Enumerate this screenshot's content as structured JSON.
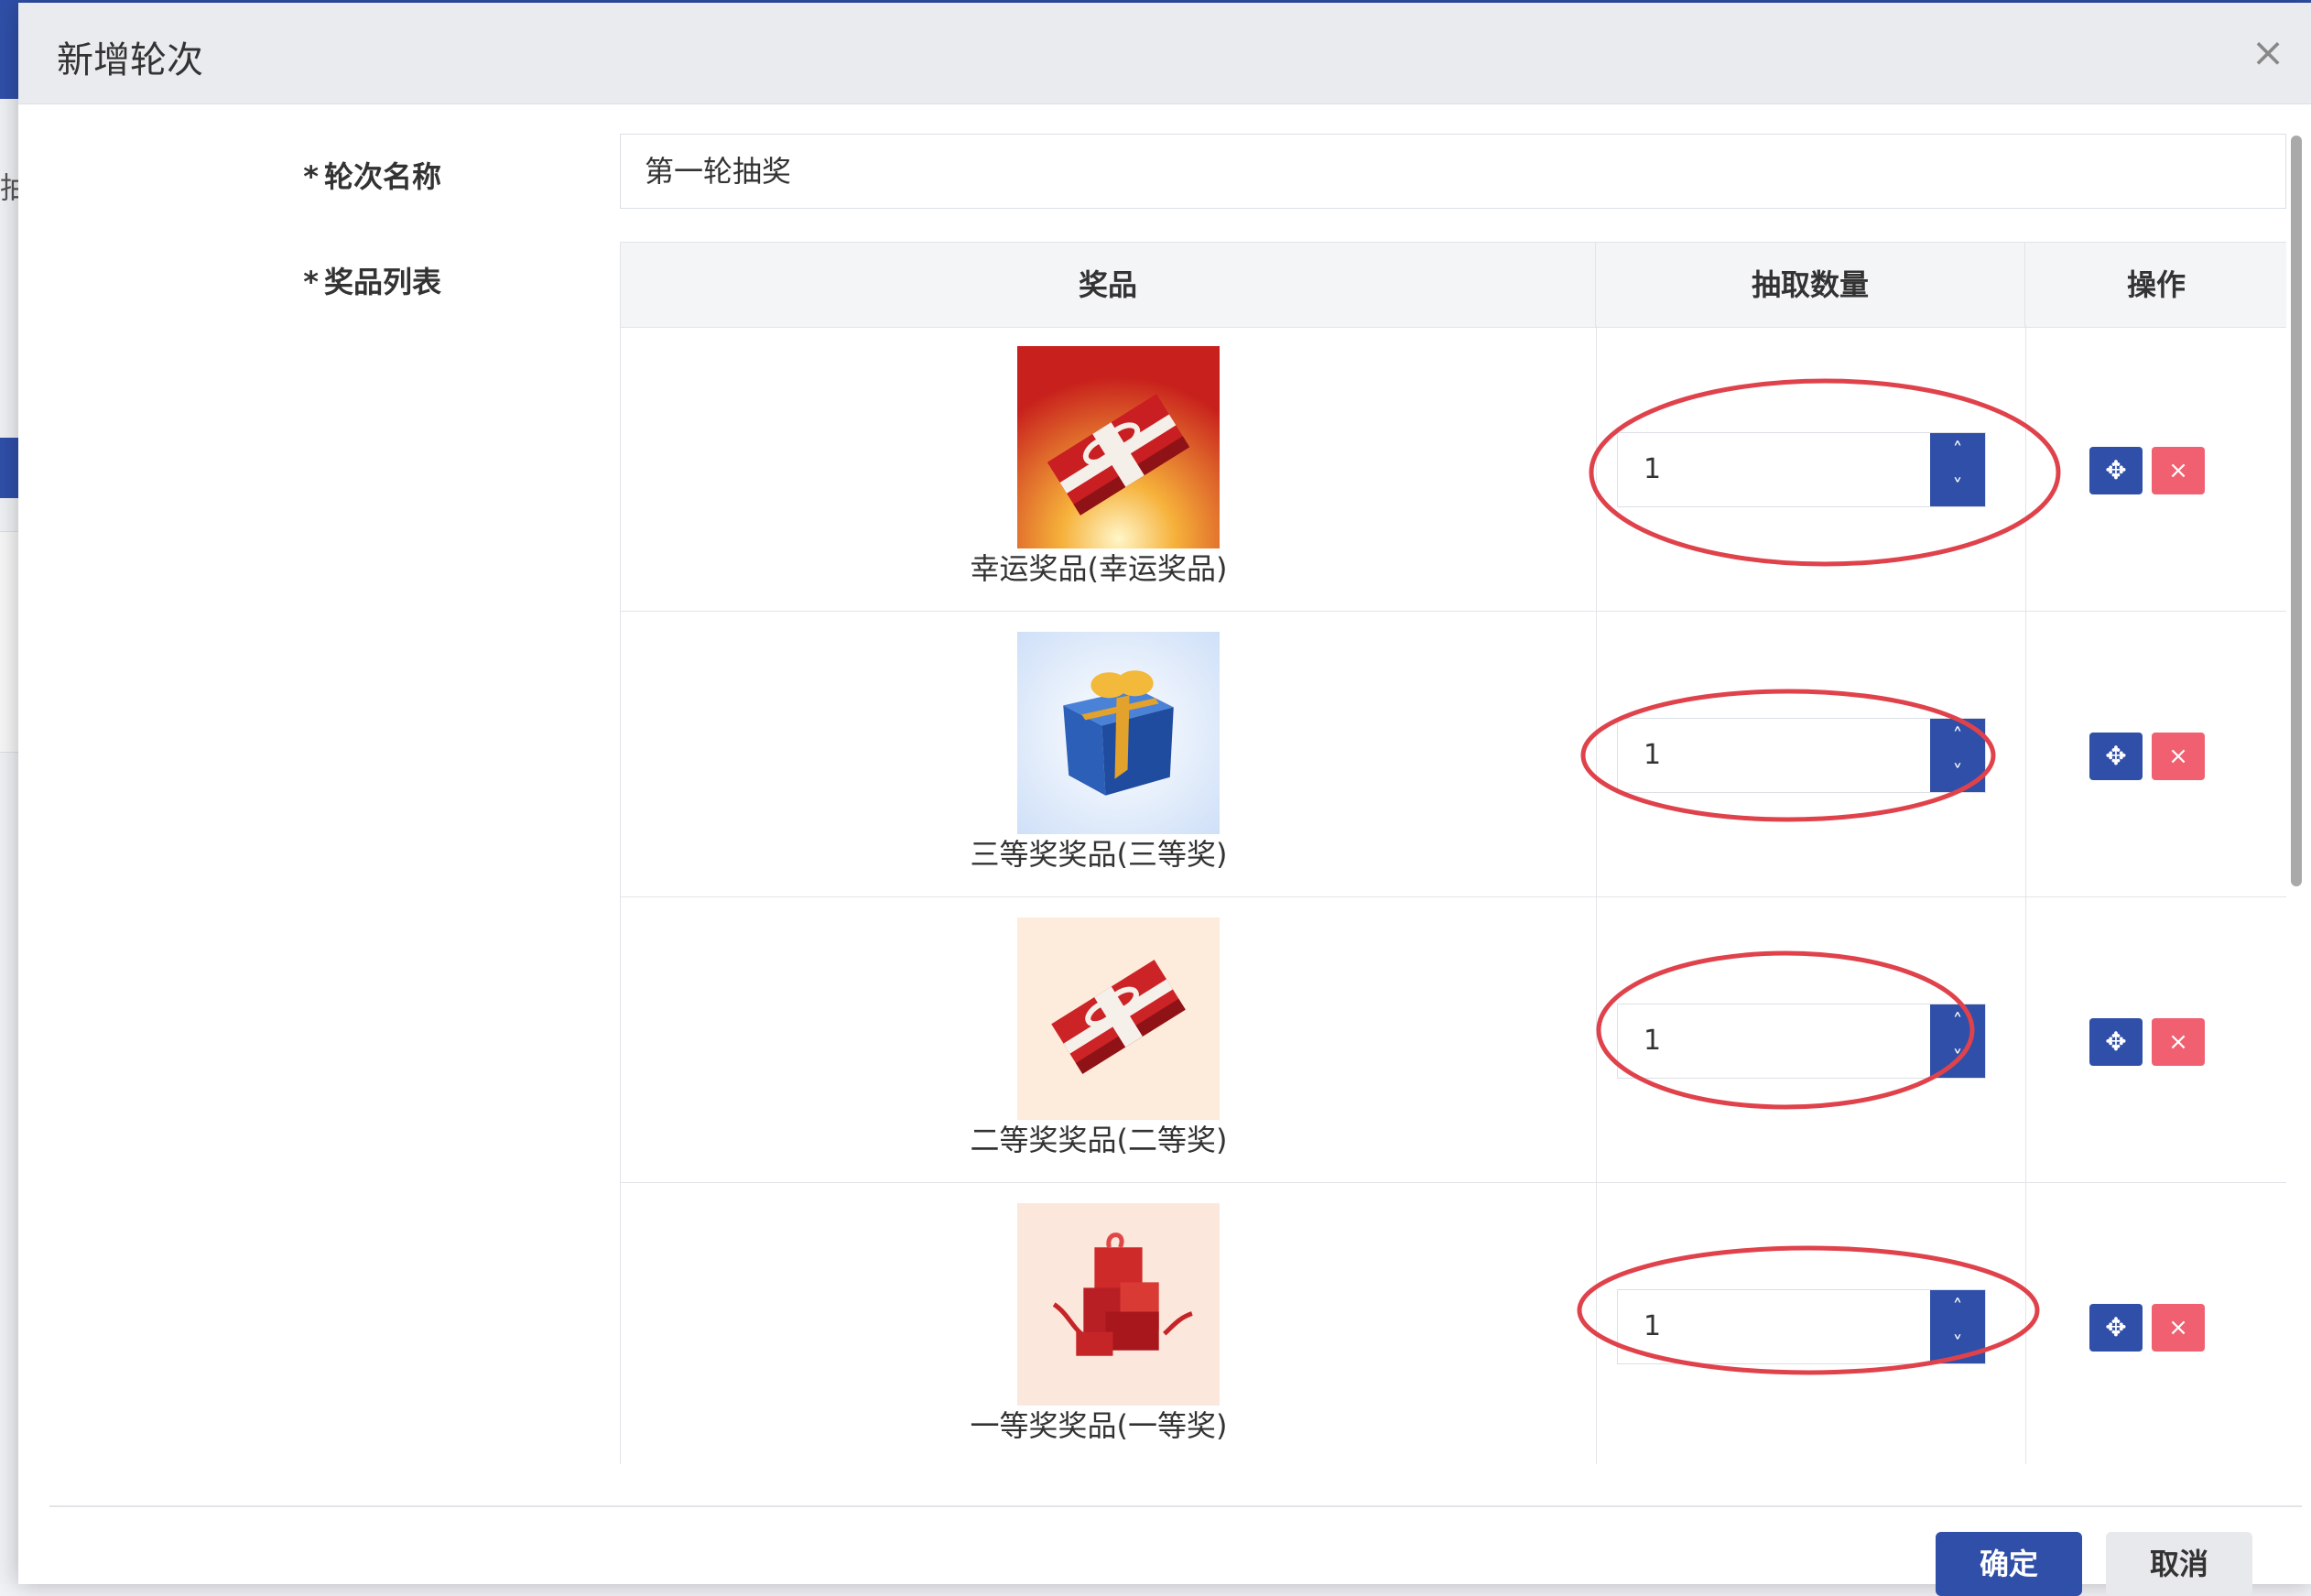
{
  "dialog": {
    "title": "新增轮次",
    "close_symbol": "×"
  },
  "form": {
    "round_name_label": "轮次名称",
    "round_name_value": "第一轮抽奖",
    "prize_list_label": "奖品列表",
    "required_mark": "*"
  },
  "table": {
    "columns": [
      "奖品",
      "抽取数量",
      "操作"
    ],
    "rows": [
      {
        "prize_name": "幸运奖品(幸运奖品)",
        "quantity": "1",
        "image": "red-gift-box-on-orange-glow"
      },
      {
        "prize_name": "三等奖奖品(三等奖)",
        "quantity": "1",
        "image": "blue-gift-box-with-gold-ribbon"
      },
      {
        "prize_name": "二等奖奖品(二等奖)",
        "quantity": "1",
        "image": "red-gift-box-on-cream"
      },
      {
        "prize_name": "一等奖奖品(一等奖)",
        "quantity": "1",
        "image": "stack-of-red-gift-boxes"
      }
    ]
  },
  "icons": {
    "increment": "chevron-up-icon",
    "decrement": "chevron-down-icon",
    "move": "move-arrows-icon",
    "delete": "close-icon",
    "up_symbol": "˄",
    "down_symbol": "˅",
    "move_symbol": "✥",
    "delete_symbol": "×"
  },
  "footer": {
    "confirm_label": "确定",
    "cancel_label": "取消"
  },
  "colors": {
    "primary": "#2f4fa8",
    "danger": "#f06070",
    "annotation_ring": "#e0424b"
  },
  "background": {
    "side_text": "抽"
  }
}
